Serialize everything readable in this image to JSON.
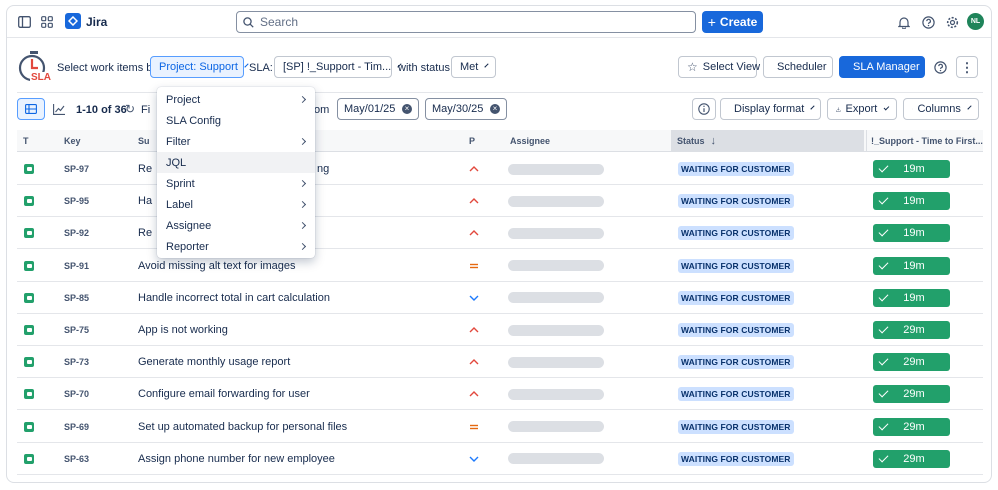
{
  "topbar": {
    "app_name": "Jira",
    "search_placeholder": "Search",
    "create_label": "Create",
    "user_initials": "NL"
  },
  "sla_toolbar": {
    "logo_text": "SLA",
    "select_label": "Select work items by:",
    "project_select": "Project: Support",
    "sla_label": "SLA:",
    "sla_select": "[SP] !_Support - Tim...",
    "status_label": "with status:",
    "status_select": "Met",
    "select_view_label": "Select View",
    "scheduler_label": "Scheduler",
    "sla_manager_label": "SLA Manager"
  },
  "filter_toolbar": {
    "range_text": "1-10 of 36",
    "partial_label": "Fi",
    "partial_from": "om",
    "date_start": "May/01/25",
    "date_end": "May/30/25",
    "display_format_label": "Display format",
    "export_label": "Export",
    "columns_label": "Columns"
  },
  "dropdown": {
    "items": [
      {
        "label": "Project",
        "submenu": true
      },
      {
        "label": "SLA Config",
        "submenu": false
      },
      {
        "label": "Filter",
        "submenu": true
      },
      {
        "label": "JQL",
        "submenu": false
      },
      {
        "label": "Sprint",
        "submenu": true
      },
      {
        "label": "Label",
        "submenu": true
      },
      {
        "label": "Assignee",
        "submenu": true
      },
      {
        "label": "Reporter",
        "submenu": true
      }
    ]
  },
  "table": {
    "headers": {
      "type": "T",
      "key": "Key",
      "summary": "Su",
      "priority": "P",
      "assignee": "Assignee",
      "status": "Status",
      "sla": "!_Support - Time to First..."
    },
    "rows": [
      {
        "key": "SP-97",
        "summary": "Re",
        "summary_tail": "ng",
        "priority": "high",
        "status": "WAITING FOR CUSTOMER",
        "sla": "19m"
      },
      {
        "key": "SP-95",
        "summary": "Ha",
        "summary_tail": "",
        "priority": "high",
        "status": "WAITING FOR CUSTOMER",
        "sla": "19m"
      },
      {
        "key": "SP-92",
        "summary": "Re",
        "summary_tail": "",
        "priority": "high",
        "status": "WAITING FOR CUSTOMER",
        "sla": "19m"
      },
      {
        "key": "SP-91",
        "summary": "Avoid missing alt text for images",
        "summary_tail": "",
        "priority": "medium",
        "status": "WAITING FOR CUSTOMER",
        "sla": "19m"
      },
      {
        "key": "SP-85",
        "summary": "Handle incorrect total in cart calculation",
        "summary_tail": "",
        "priority": "low",
        "status": "WAITING FOR CUSTOMER",
        "sla": "19m"
      },
      {
        "key": "SP-75",
        "summary": "App is not working",
        "summary_tail": "",
        "priority": "high",
        "status": "WAITING FOR CUSTOMER",
        "sla": "29m"
      },
      {
        "key": "SP-73",
        "summary": "Generate monthly usage report",
        "summary_tail": "",
        "priority": "high",
        "status": "WAITING FOR CUSTOMER",
        "sla": "29m"
      },
      {
        "key": "SP-70",
        "summary": "Configure email forwarding for user",
        "summary_tail": "",
        "priority": "high",
        "status": "WAITING FOR CUSTOMER",
        "sla": "29m"
      },
      {
        "key": "SP-69",
        "summary": "Set up automated backup for personal files",
        "summary_tail": "",
        "priority": "medium",
        "status": "WAITING FOR CUSTOMER",
        "sla": "29m"
      },
      {
        "key": "SP-63",
        "summary": "Assign phone number for new employee",
        "summary_tail": "",
        "priority": "low",
        "status": "WAITING FOR CUSTOMER",
        "sla": "29m"
      }
    ]
  },
  "colors": {
    "brand": "#1868db",
    "priority_high": "#e2483d",
    "priority_medium": "#e56910",
    "priority_low": "#1d7afc",
    "sla_met": "#22a06b",
    "status_bg": "#cce0ff"
  }
}
